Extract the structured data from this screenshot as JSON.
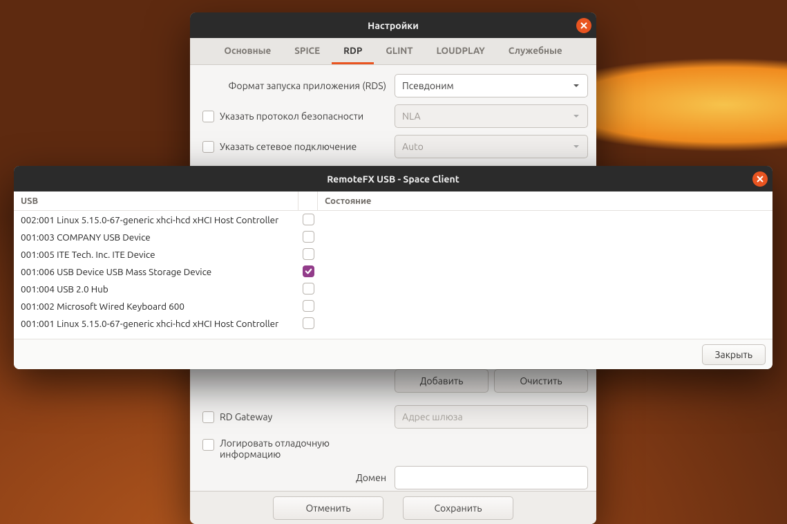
{
  "settings": {
    "title": "Настройки",
    "tabs": [
      {
        "label": "Основные"
      },
      {
        "label": "SPICE"
      },
      {
        "label": "RDP"
      },
      {
        "label": "GLINT"
      },
      {
        "label": "LOUDPLAY"
      },
      {
        "label": "Служебные"
      }
    ],
    "active_tab_index": 2,
    "rds_label": "Формат запуска приложения (RDS)",
    "rds_value": "Псевдоним",
    "sec_label": "Указать протокол безопасности",
    "sec_value": "NLA",
    "net_label": "Указать сетевое подключение",
    "net_value": "Auto",
    "add_label": "Добавить",
    "clear_label": "Очистить",
    "rdgw_label": "RD Gateway",
    "rdgw_placeholder": "Адрес шлюза",
    "log_label": "Логировать отладочную информацию",
    "domain_label": "Домен",
    "cancel_label": "Отменить",
    "save_label": "Сохранить"
  },
  "usb": {
    "title": "RemoteFX USB  -  Space Client",
    "col_usb": "USB",
    "col_state": "Состояние",
    "rows": [
      {
        "name": "002:001 Linux 5.15.0-67-generic xhci-hcd xHCI Host Controller",
        "checked": false
      },
      {
        "name": "001:003 COMPANY USB Device",
        "checked": false
      },
      {
        "name": "001:005 ITE Tech. Inc. ITE Device",
        "checked": false
      },
      {
        "name": "001:006 USB Device USB Mass Storage Device",
        "checked": true
      },
      {
        "name": "001:004 USB 2.0 Hub",
        "checked": false
      },
      {
        "name": "001:002 Microsoft Wired Keyboard 600",
        "checked": false
      },
      {
        "name": "001:001 Linux 5.15.0-67-generic xhci-hcd xHCI Host Controller",
        "checked": false
      }
    ],
    "close_label": "Закрыть"
  }
}
